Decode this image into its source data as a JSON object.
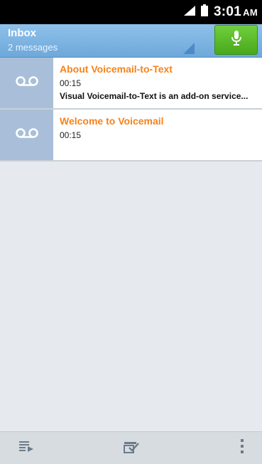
{
  "status_bar": {
    "time": "3:01",
    "ampm": "AM"
  },
  "header": {
    "title": "Inbox",
    "subtitle": "2 messages"
  },
  "colors": {
    "accent_orange": "#f7821b",
    "header_blue": "#7eb5e4",
    "mic_green": "#5cbd2a"
  },
  "messages": [
    {
      "title": "About Voicemail-to-Text",
      "duration": "00:15",
      "preview": "Visual Voicemail-to-Text is an add-on service..."
    },
    {
      "title": "Welcome to Voicemail",
      "duration": "00:15",
      "preview": ""
    }
  ],
  "icons": {
    "mic": "microphone-icon",
    "voicemail": "voicemail-icon",
    "play_all": "play-list-icon",
    "select": "select-check-icon",
    "overflow": "overflow-menu-icon"
  }
}
